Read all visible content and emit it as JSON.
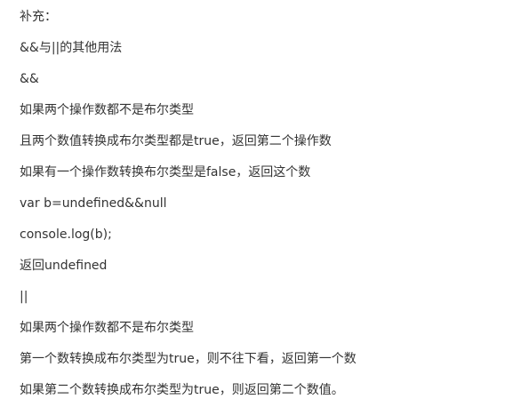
{
  "lines": [
    "补充：",
    "&&与||的其他用法",
    "&&",
    "如果两个操作数都不是布尔类型",
    "且两个数值转换成布尔类型都是true，返回第二个操作数",
    "如果有一个操作数转换布尔类型是false，返回这个数",
    "var b=undefined&&null",
    "console.log(b);",
    "返回undefined",
    "||",
    "如果两个操作数都不是布尔类型",
    "第一个数转换成布尔类型为true，则不往下看，返回第一个数",
    "如果第二个数转换成布尔类型为true，则返回第二个数值。"
  ]
}
